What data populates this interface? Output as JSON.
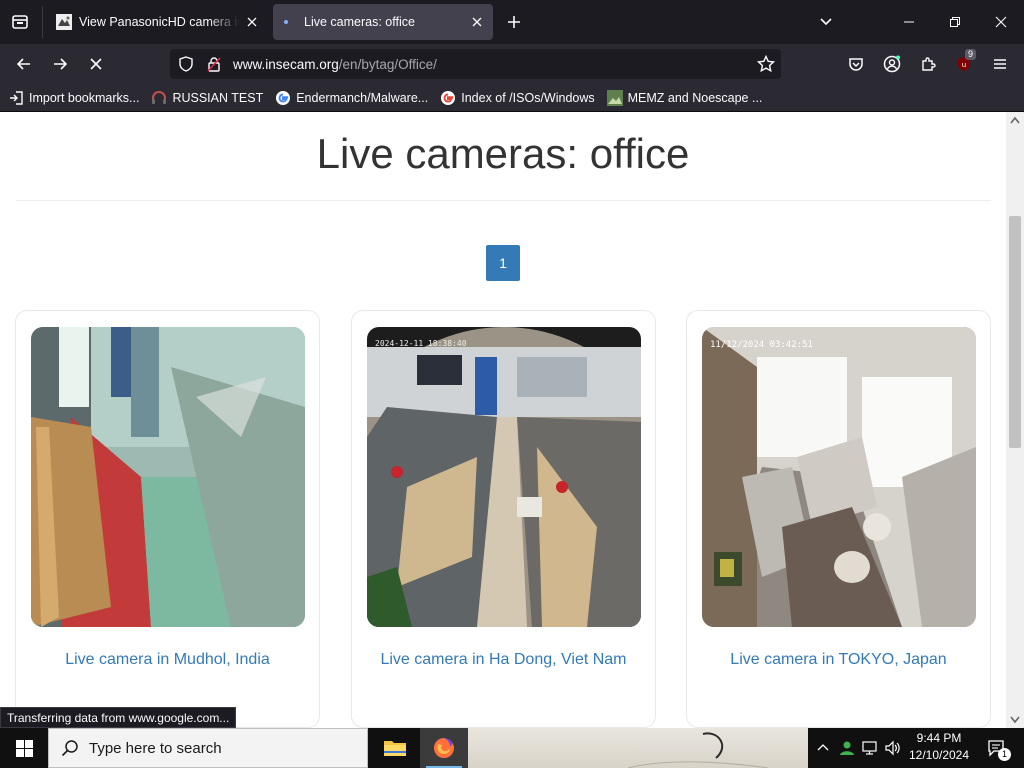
{
  "browser": {
    "tabs": [
      {
        "title": "View PanasonicHD camera in Ja",
        "active": false
      },
      {
        "title": "Live cameras: office",
        "active": true
      }
    ],
    "url": {
      "host": "www.insecam.org",
      "path": "/en/bytag/Office/"
    },
    "bookmarks": [
      {
        "label": "Import bookmarks...",
        "icon": "import-icon"
      },
      {
        "label": "RUSSIAN TEST",
        "icon": "headphones-icon"
      },
      {
        "label": "Endermanch/Malware...",
        "icon": "google-icon"
      },
      {
        "label": "Index of /ISOs/Windows",
        "icon": "google-icon"
      },
      {
        "label": "MEMZ and Noescape ...",
        "icon": "image-icon"
      }
    ],
    "ublock_count": "9",
    "status_text": "Transferring data from www.google.com..."
  },
  "page": {
    "title": "Live cameras: office",
    "pagination": {
      "current": "1"
    },
    "cameras": [
      {
        "caption": "Live camera in Mudhol, India",
        "timestamp": ""
      },
      {
        "caption": "Live camera in Ha Dong, Viet Nam",
        "timestamp": "2024-12-11  18:38:40"
      },
      {
        "caption": "Live camera in TOKYO, Japan",
        "timestamp": "11/12/2024 03:42:51"
      }
    ]
  },
  "taskbar": {
    "search_placeholder": "Type here to search",
    "time": "9:44 PM",
    "date": "12/10/2024",
    "notification_count": "1"
  },
  "colors": {
    "link": "#337ab7",
    "chrome_dark": "#1c1b22",
    "chrome_toolbar": "#2b2a33"
  }
}
